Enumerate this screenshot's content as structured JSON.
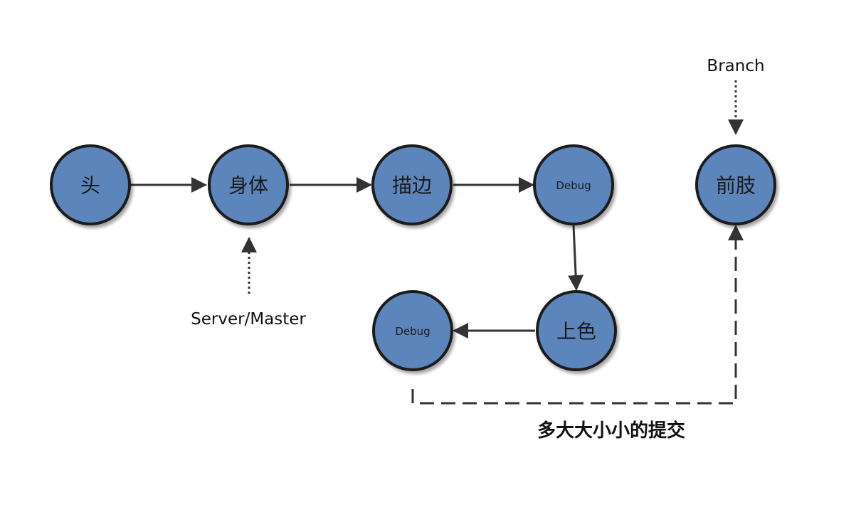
{
  "colors": {
    "node_fill": "#5b86bb",
    "node_stroke": "#1e1e1e",
    "edge": "#333333",
    "text": "#111111"
  },
  "nodes": {
    "head": "头",
    "body": "身体",
    "outline": "描边",
    "debug_top": "Debug",
    "coloring": "上色",
    "debug_bottom": "Debug",
    "limbs": "前肢"
  },
  "pointers": {
    "server_master": "Server/Master",
    "branch": "Branch"
  },
  "caption": "多大大小小的提交"
}
